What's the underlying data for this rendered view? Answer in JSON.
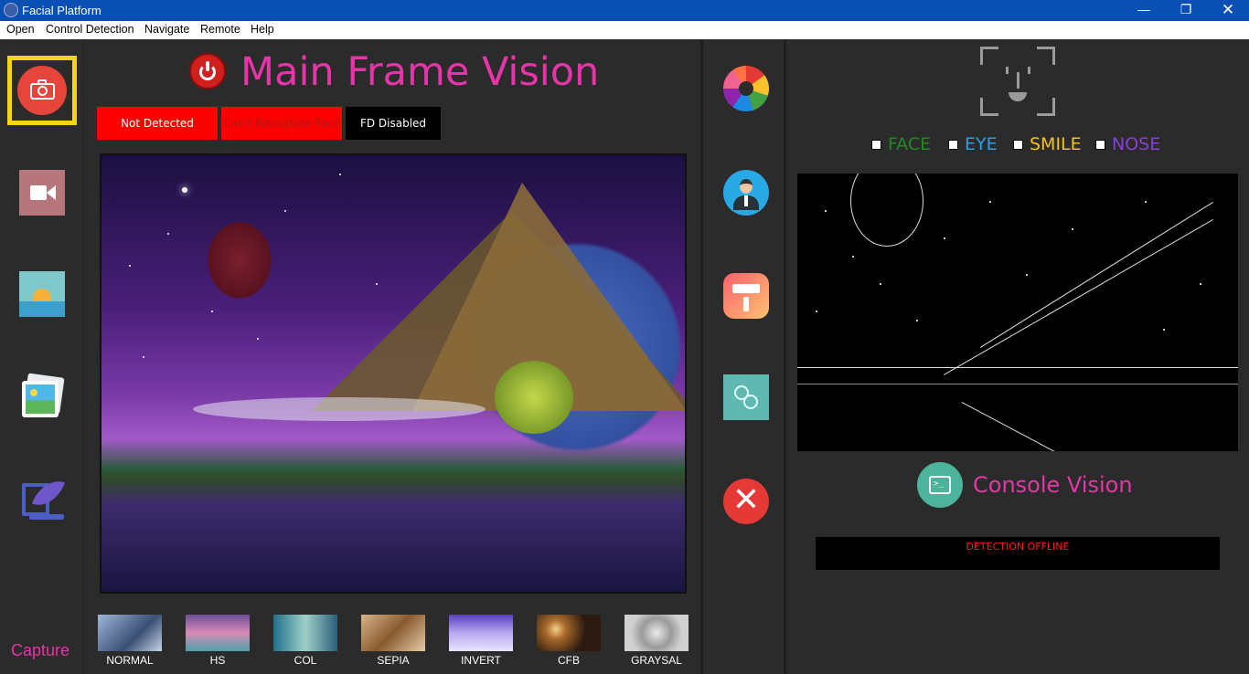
{
  "window": {
    "title": "Facial Platform",
    "controls": {
      "minimize": "—",
      "maximize": "❐",
      "close": "✕"
    }
  },
  "menu": [
    "Open",
    "Control Detection",
    "Navigate",
    "Remote",
    "Help"
  ],
  "left_toolbar": {
    "tools": [
      "camera-icon",
      "video-icon",
      "sunset-icon",
      "gallery-icon",
      "quill-icon"
    ],
    "active_tool": "camera-icon",
    "capture_label": "Capture"
  },
  "main": {
    "title": "Main Frame Vision",
    "status": {
      "detection": "Not Detected",
      "recognition": "Can't Recognize Face",
      "fd_state": "FD Disabled"
    }
  },
  "filters": [
    {
      "label": "NORMAL"
    },
    {
      "label": "HS"
    },
    {
      "label": "COL"
    },
    {
      "label": "SEPIA"
    },
    {
      "label": "INVERT"
    },
    {
      "label": "CFB"
    },
    {
      "label": "GRAYSAL"
    }
  ],
  "mid_toolbar": [
    "color-wheel-icon",
    "user-icon",
    "paint-roller-icon",
    "face-filter-icon",
    "close-icon"
  ],
  "right": {
    "checkboxes": [
      {
        "label": "FACE",
        "color": "#1f8a1f",
        "checked": false
      },
      {
        "label": "EYE",
        "color": "#2aa0e6",
        "checked": false
      },
      {
        "label": "SMILE",
        "color": "#f4c21a",
        "checked": false
      },
      {
        "label": "NOSE",
        "color": "#8a3fd6",
        "checked": false
      }
    ],
    "console_title": "Console Vision",
    "console_message": "DETECTION OFFLINE"
  },
  "colors": {
    "accent": "#e535a8",
    "title_bar": "#0a4fb4",
    "panel_bg": "#2b2b2b",
    "active_highlight": "#f4d511",
    "error": "#ff0000"
  }
}
